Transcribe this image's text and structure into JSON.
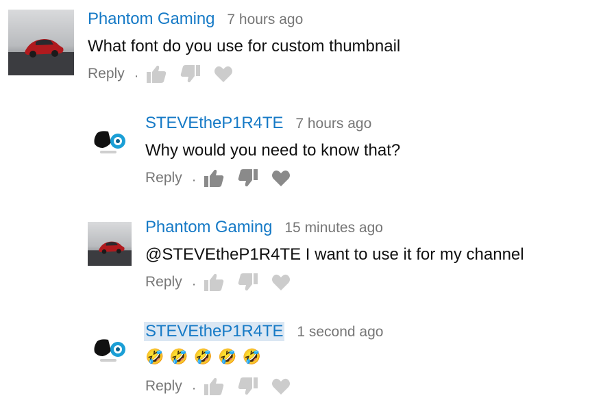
{
  "colors": {
    "author_link": "#167ac6",
    "timestamp": "#767676",
    "body_text": "#111111",
    "icon_light": "#cccccc",
    "icon_dark": "#8a8a8a",
    "mention_highlight": "#dbe7f3"
  },
  "comments": [
    {
      "author": "Phantom Gaming",
      "time": "7 hours ago",
      "text": "What font do you use for custom thumbnail",
      "reply_label": "Reply",
      "separator": "·",
      "avatar": "red-sports-car-avatar",
      "icons": [
        "thumbs-up-icon",
        "thumbs-down-icon",
        "heart-icon"
      ]
    },
    {
      "author": "STEVEtheP1R4TE",
      "time": "7 hours ago",
      "text": "Why would you need to know that?",
      "reply_label": "Reply",
      "separator": "·",
      "avatar": "game-controller-avatar",
      "icons": [
        "thumbs-up-icon",
        "thumbs-down-icon",
        "heart-icon"
      ]
    },
    {
      "author": "Phantom Gaming",
      "time": "15 minutes ago",
      "text": "@STEVEtheP1R4TE I want to use it for my channel",
      "reply_label": "Reply",
      "separator": "·",
      "avatar": "red-sports-car-avatar",
      "icons": [
        "thumbs-up-icon",
        "thumbs-down-icon",
        "heart-icon"
      ]
    },
    {
      "author": "STEVEtheP1R4TE",
      "time": "1 second ago",
      "text": "🤣🤣🤣🤣🤣",
      "reply_label": "Reply",
      "separator": "·",
      "avatar": "game-controller-avatar",
      "icons": [
        "thumbs-up-icon",
        "thumbs-down-icon",
        "heart-icon"
      ]
    }
  ]
}
